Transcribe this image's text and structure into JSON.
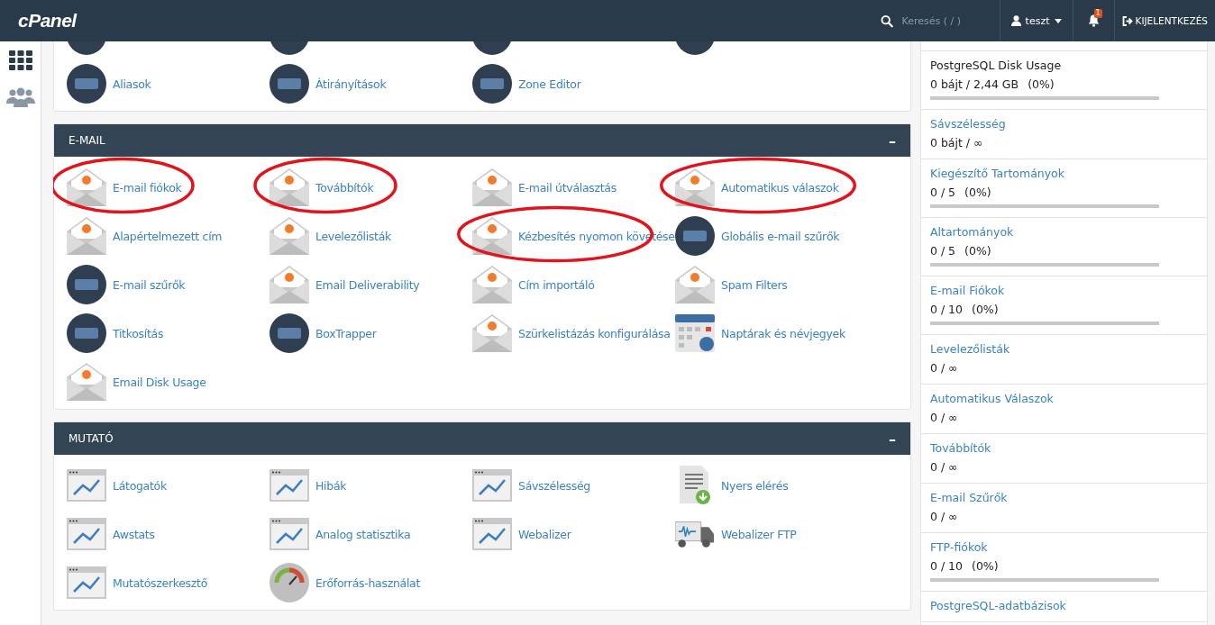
{
  "header": {
    "logo": "cPanel",
    "search": {
      "placeholder": "Keresés ( / )"
    },
    "user": "teszt",
    "notifications": "1",
    "logout": "KIJELENTKEZÉS"
  },
  "top_panel": {
    "items": [
      {
        "kind": "circle"
      },
      {
        "kind": "circle"
      },
      {
        "kind": "circle"
      },
      {
        "kind": "circle"
      },
      {
        "label": "Aliasok",
        "kind": "circle"
      },
      {
        "label": "Átirányítások",
        "kind": "circle"
      },
      {
        "label": "Zone Editor",
        "kind": "circle"
      }
    ]
  },
  "sections": [
    {
      "title": "E-MAIL",
      "collapse": "–",
      "items": [
        {
          "label": "E-mail fiókok",
          "kind": "envelope",
          "circled": true
        },
        {
          "label": "Továbbítók",
          "kind": "envelope",
          "circled": true
        },
        {
          "label": "E-mail útválasztás",
          "kind": "envelope",
          "circled": false
        },
        {
          "label": "Automatikus válaszok",
          "kind": "envelope",
          "circled": true
        },
        {
          "label": "Alapértelmezett cím",
          "kind": "envelope",
          "circled": false
        },
        {
          "label": "Levelezőlisták",
          "kind": "envelope",
          "circled": false
        },
        {
          "label": "Kézbesítés nyomon követése",
          "kind": "envelope",
          "circled": true
        },
        {
          "label": "Globális e-mail szűrők",
          "kind": "circle",
          "circled": false
        },
        {
          "label": "E-mail szűrők",
          "kind": "circle",
          "circled": false
        },
        {
          "label": "Email Deliverability",
          "kind": "envelope",
          "circled": false
        },
        {
          "label": "Cím importáló",
          "kind": "envelope",
          "circled": false
        },
        {
          "label": "Spam Filters",
          "kind": "envelope",
          "circled": false
        },
        {
          "label": "Titkosítás",
          "kind": "circle",
          "circled": false
        },
        {
          "label": "BoxTrapper",
          "kind": "circle",
          "circled": false
        },
        {
          "label": "Szürkelistázás konfigurálása",
          "kind": "envelope",
          "circled": false
        },
        {
          "label": "Naptárak és névjegyek",
          "kind": "calendar",
          "circled": false
        },
        {
          "label": "Email Disk Usage",
          "kind": "envelope",
          "circled": false
        }
      ]
    },
    {
      "title": "MUTATÓ",
      "collapse": "–",
      "items": [
        {
          "label": "Látogatók",
          "kind": "window",
          "circled": false
        },
        {
          "label": "Hibák",
          "kind": "window",
          "circled": false
        },
        {
          "label": "Sávszélesség",
          "kind": "window",
          "circled": false
        },
        {
          "label": "Nyers elérés",
          "kind": "document",
          "circled": false
        },
        {
          "label": "Awstats",
          "kind": "window",
          "circled": false
        },
        {
          "label": "Analog statisztika",
          "kind": "window",
          "circled": false
        },
        {
          "label": "Webalizer",
          "kind": "window",
          "circled": false
        },
        {
          "label": "Webalizer FTP",
          "kind": "truck",
          "circled": false
        },
        {
          "label": "Mutatószerkesztő",
          "kind": "window",
          "circled": false
        },
        {
          "label": "Erőforrás-használat",
          "kind": "gauge",
          "circled": false
        }
      ]
    }
  ],
  "stats": [
    {
      "label": "PostgreSQL Disk Usage",
      "kind": "plain",
      "value": "0 bájt / 2,44 GB",
      "percent": "(0%)",
      "level": 0
    },
    {
      "label": "Sávszélesség",
      "kind": "link",
      "value": "0 bájt / ∞"
    },
    {
      "label": "Kiegészítő Tartományok",
      "kind": "link",
      "value": "0 / 5",
      "percent": "(0%)",
      "level": 0
    },
    {
      "label": "Altartományok",
      "kind": "link",
      "value": "0 / 5",
      "percent": "(0%)",
      "level": 0
    },
    {
      "label": "E-mail Fiókok",
      "kind": "link",
      "value": "0 / 10",
      "percent": "(0%)",
      "level": 0
    },
    {
      "label": "Levelezőlisták",
      "kind": "link",
      "value": "0 / ∞"
    },
    {
      "label": "Automatikus Válaszok",
      "kind": "link",
      "value": "0 / ∞"
    },
    {
      "label": "Továbbítók",
      "kind": "link",
      "value": "0 / ∞"
    },
    {
      "label": "E-mail Szűrők",
      "kind": "link",
      "value": "0 / ∞"
    },
    {
      "label": "FTP-fiókok",
      "kind": "link",
      "value": "0 / 10",
      "percent": "(0%)",
      "level": 0
    },
    {
      "label": "PostgreSQL-adatbázisok",
      "kind": "link"
    }
  ]
}
